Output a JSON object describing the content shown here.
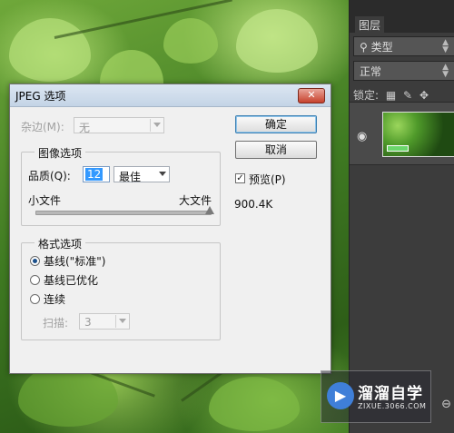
{
  "panel": {
    "tab_label": "图层",
    "kind_filter": "类型",
    "blend_mode": "正常",
    "lock_label": "锁定:"
  },
  "dialog": {
    "title": "JPEG 选项",
    "close_symbol": "✕",
    "matte_label": "杂边(M):",
    "matte_value": "无",
    "ok_label": "确定",
    "cancel_label": "取消",
    "preview_label": "预览(P)",
    "preview_checked": true,
    "file_size": "900.4K",
    "image_options": {
      "title": "图像选项",
      "quality_label": "品质(Q):",
      "quality_value": "12",
      "quality_preset": "最佳",
      "small_file_label": "小文件",
      "large_file_label": "大文件",
      "slider_fraction": 1.0
    },
    "format_options": {
      "title": "格式选项",
      "options": [
        {
          "label": "基线(\"标准\")",
          "selected": true
        },
        {
          "label": "基线已优化",
          "selected": false
        },
        {
          "label": "连续",
          "selected": false
        }
      ],
      "scans_label": "扫描:",
      "scans_value": "3"
    }
  },
  "watermark": {
    "name": "溜溜自学",
    "url": "ZIXUE.3066.COM"
  }
}
